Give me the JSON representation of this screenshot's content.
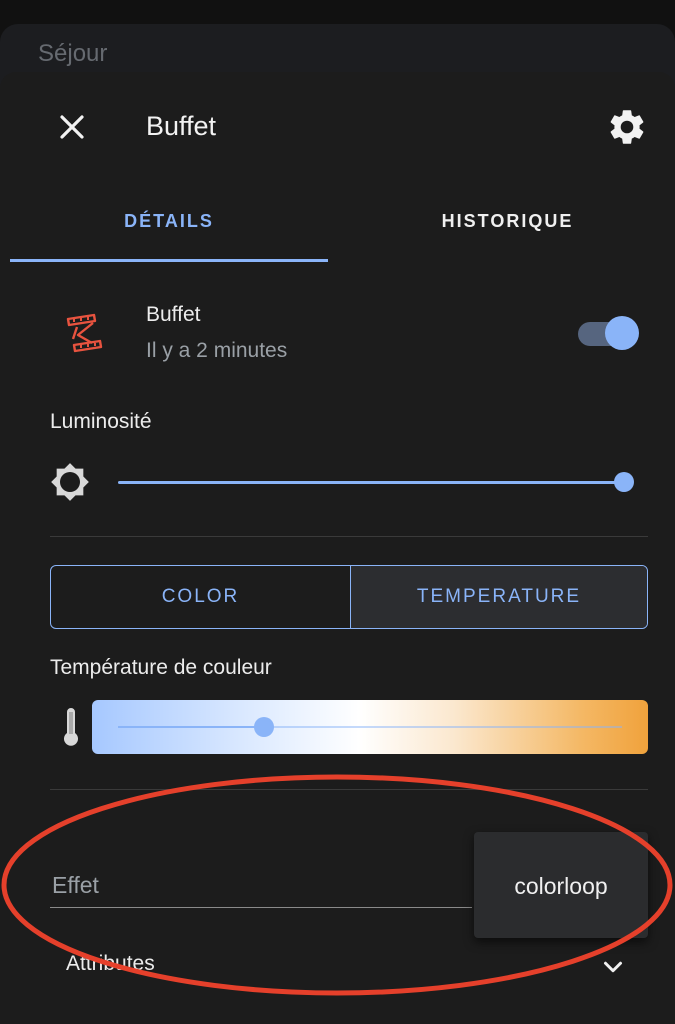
{
  "background": {
    "room_title": "Séjour"
  },
  "dialog": {
    "title": "Buffet",
    "tabs": [
      {
        "label": "DÉTAILS",
        "active": true
      },
      {
        "label": "HISTORIQUE",
        "active": false
      }
    ],
    "entity": {
      "name": "Buffet",
      "last_changed": "Il y a 2 minutes",
      "state_on": true
    },
    "brightness": {
      "label": "Luminosité",
      "value_percent": 100
    },
    "mode_buttons": [
      {
        "label": "COLOR",
        "selected": false
      },
      {
        "label": "TEMPERATURE",
        "selected": true
      }
    ],
    "color_temperature": {
      "label": "Température de couleur",
      "value_fraction": 0.29
    },
    "effect": {
      "label": "Effet",
      "options": [
        "colorloop"
      ]
    },
    "attributes": {
      "label": "Attributes"
    }
  },
  "icons": {
    "close": "close-icon",
    "settings": "gear-icon",
    "entity": "light-strip-icon",
    "brightness": "brightness-icon",
    "temperature": "thermometer-icon",
    "expand": "chevron-down-icon"
  },
  "colors": {
    "accent": "#8ab4f8",
    "dialog_bg": "#1c1c1c",
    "entity_icon": "#e8533f",
    "annotation": "#e5402b"
  }
}
